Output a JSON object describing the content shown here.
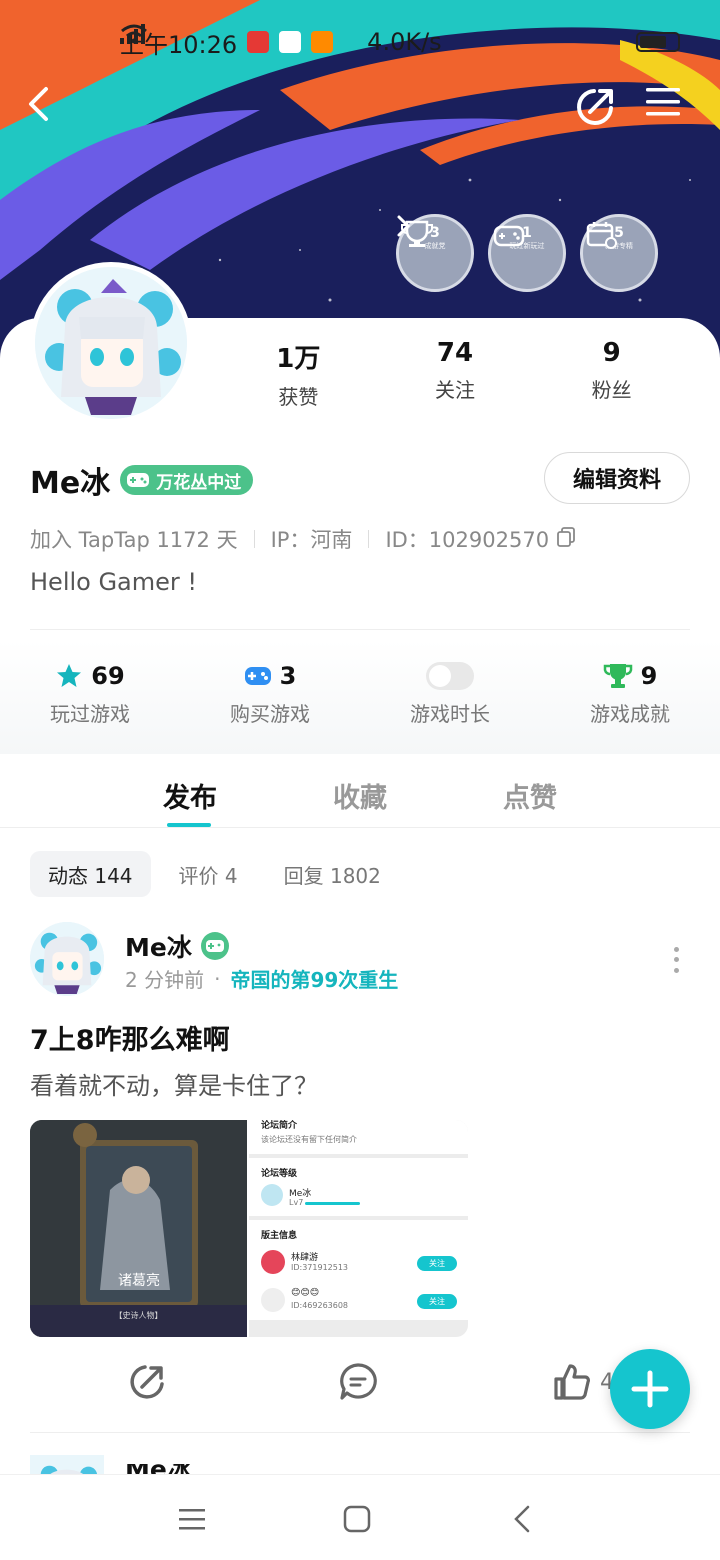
{
  "status_bar": {
    "time": "上午10:26",
    "net_speed": "4.0K/s"
  },
  "badges": [
    {
      "count": "3",
      "caption": "成就党"
    },
    {
      "count": "1",
      "caption": "玩过新玩过"
    },
    {
      "count": "5",
      "caption": "新游专精"
    }
  ],
  "profile": {
    "stats": [
      {
        "value": "1万",
        "label": "获赞"
      },
      {
        "value": "74",
        "label": "关注"
      },
      {
        "value": "9",
        "label": "粉丝"
      }
    ],
    "name": "Me冰",
    "level_tag": "万花丛中过",
    "edit_label": "编辑资料",
    "joined": "加入 TapTap 1172 天",
    "ip": "IP：河南",
    "id": "ID：102902570",
    "bio": "Hello Gamer !"
  },
  "game_stats": [
    {
      "value": "69",
      "label": "玩过游戏"
    },
    {
      "value": "3",
      "label": "购买游戏"
    },
    {
      "value": "",
      "label": "游戏时长"
    },
    {
      "value": "9",
      "label": "游戏成就"
    }
  ],
  "tabs": [
    "发布",
    "收藏",
    "点赞"
  ],
  "subtabs": [
    "动态 144",
    "评价 4",
    "回复 1802"
  ],
  "post": {
    "author": "Me冰",
    "time": "2 分钟前",
    "dot": "·",
    "game": "帝国的第99次重生",
    "title": "7上8咋那么难啊",
    "body": "看着就不动，算是卡住了？",
    "like_count": "4",
    "image1": {
      "hero": "诸葛亮",
      "caption": "【史诗人物】"
    },
    "image2": {
      "section1": "论坛简介",
      "section1_text": "该论坛还没有留下任何简介",
      "section2": "论坛等级",
      "user": "Me冰",
      "user_lv": "Lv7",
      "section3": "版主信息",
      "mod1": "林肆游",
      "mod1_id": "ID:371912513",
      "mod2": "😊😊😊",
      "mod2_id": "ID:469263608",
      "follow": "关注"
    }
  },
  "next_post": {
    "author": "Me冰"
  },
  "colors": {
    "accent": "#15c5ce",
    "level_green": "#4cc28a",
    "banner": "#1a1f5c"
  }
}
